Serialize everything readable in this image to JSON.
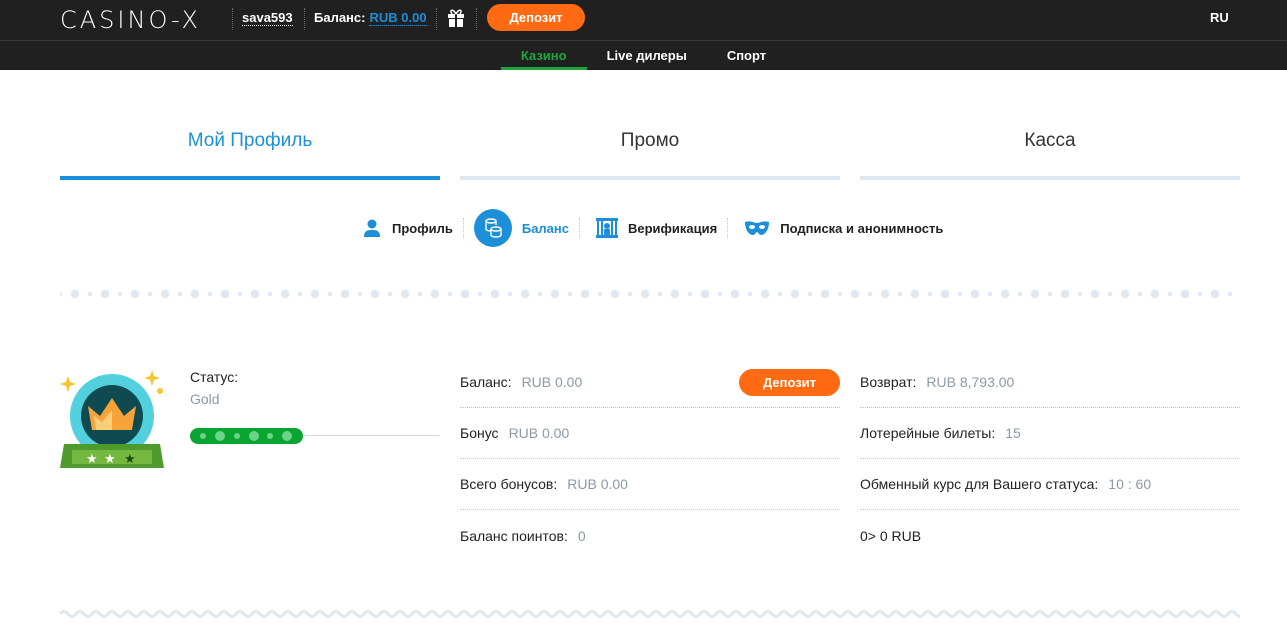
{
  "header": {
    "logo": "CASINO-X",
    "username": "sava593",
    "balance_label": "Баланс:",
    "balance_value": "RUB 0.00",
    "deposit": "Депозит",
    "lang": "RU"
  },
  "nav": [
    "Казино",
    "Live дилеры",
    "Спорт"
  ],
  "tabs": [
    "Мой Профиль",
    "Промо",
    "Касса"
  ],
  "subnav": [
    "Профиль",
    "Баланс",
    "Верификация",
    "Подписка и анонимность"
  ],
  "status": {
    "label": "Статус:",
    "value": "Gold",
    "progress_percent": 45
  },
  "left_col": [
    {
      "label": "Баланс:",
      "value": "RUB 0.00"
    },
    {
      "label": "Бонус",
      "value": "RUB 0.00"
    },
    {
      "label": "Всего бонусов:",
      "value": "RUB 0.00"
    },
    {
      "label": "Баланс поинтов:",
      "value": "0"
    }
  ],
  "deposit_button": "Депозит",
  "right_col": [
    {
      "label": "Возврат:",
      "value": "RUB 8,793.00"
    },
    {
      "label": "Лотерейные билеты:",
      "value": "15"
    },
    {
      "label": "Обменный курс для Вашего статуса:",
      "value": "10 : 60"
    },
    {
      "label": "0> 0 RUB",
      "value": ""
    }
  ]
}
